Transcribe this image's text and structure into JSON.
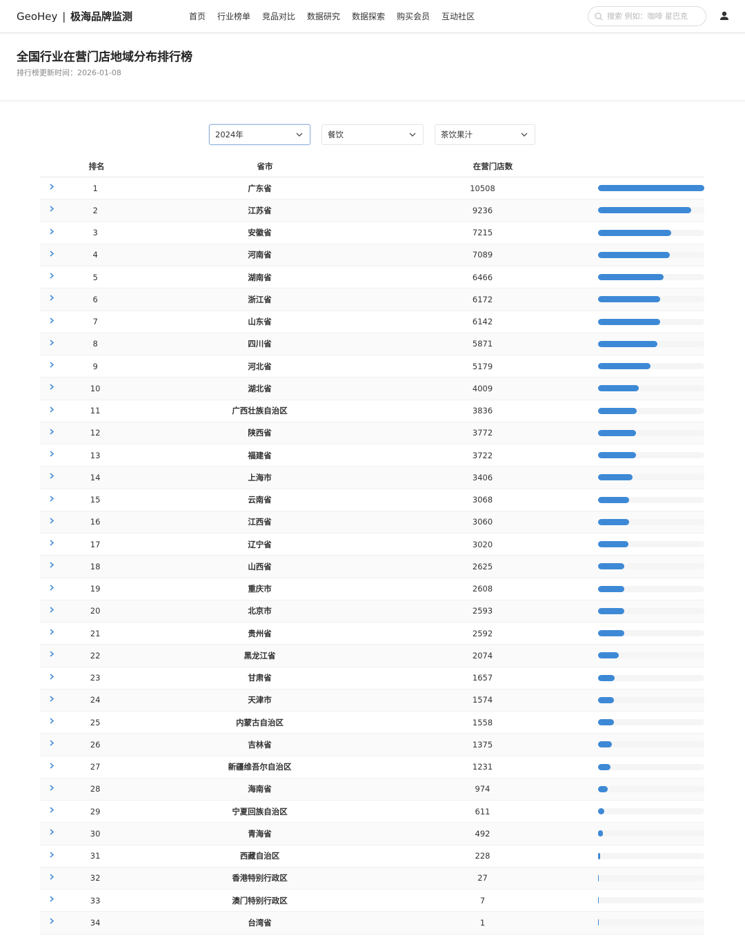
{
  "brand": {
    "en": "GeoHey",
    "sep": "|",
    "cn": "极海品牌监测"
  },
  "nav": [
    "首页",
    "行业榜单",
    "竞品对比",
    "数据研究",
    "数据探索",
    "购买会员",
    "互动社区"
  ],
  "search": {
    "placeholder": "搜索 例如：咖啡 星巴克"
  },
  "page": {
    "title": "全国行业在营门店地域分布排行榜",
    "update_time": "排行榜更新时间：2026-01-08"
  },
  "filters": {
    "year": "2024年",
    "industry": "餐饮",
    "category": "茶饮果汁"
  },
  "table": {
    "headers": {
      "rank": "排名",
      "province": "省市",
      "count": "在营门店数"
    },
    "max_value": 10508,
    "rows": [
      {
        "rank": "1",
        "province": "广东省",
        "count": "10508",
        "value": 10508
      },
      {
        "rank": "2",
        "province": "江苏省",
        "count": "9236",
        "value": 9236
      },
      {
        "rank": "3",
        "province": "安徽省",
        "count": "7215",
        "value": 7215
      },
      {
        "rank": "4",
        "province": "河南省",
        "count": "7089",
        "value": 7089
      },
      {
        "rank": "5",
        "province": "湖南省",
        "count": "6466",
        "value": 6466
      },
      {
        "rank": "6",
        "province": "浙江省",
        "count": "6172",
        "value": 6172
      },
      {
        "rank": "7",
        "province": "山东省",
        "count": "6142",
        "value": 6142
      },
      {
        "rank": "8",
        "province": "四川省",
        "count": "5871",
        "value": 5871
      },
      {
        "rank": "9",
        "province": "河北省",
        "count": "5179",
        "value": 5179
      },
      {
        "rank": "10",
        "province": "湖北省",
        "count": "4009",
        "value": 4009
      },
      {
        "rank": "11",
        "province": "广西壮族自治区",
        "count": "3836",
        "value": 3836
      },
      {
        "rank": "12",
        "province": "陕西省",
        "count": "3772",
        "value": 3772
      },
      {
        "rank": "13",
        "province": "福建省",
        "count": "3722",
        "value": 3722
      },
      {
        "rank": "14",
        "province": "上海市",
        "count": "3406",
        "value": 3406
      },
      {
        "rank": "15",
        "province": "云南省",
        "count": "3068",
        "value": 3068
      },
      {
        "rank": "16",
        "province": "江西省",
        "count": "3060",
        "value": 3060
      },
      {
        "rank": "17",
        "province": "辽宁省",
        "count": "3020",
        "value": 3020
      },
      {
        "rank": "18",
        "province": "山西省",
        "count": "2625",
        "value": 2625
      },
      {
        "rank": "19",
        "province": "重庆市",
        "count": "2608",
        "value": 2608
      },
      {
        "rank": "20",
        "province": "北京市",
        "count": "2593",
        "value": 2593
      },
      {
        "rank": "21",
        "province": "贵州省",
        "count": "2592",
        "value": 2592
      },
      {
        "rank": "22",
        "province": "黑龙江省",
        "count": "2074",
        "value": 2074
      },
      {
        "rank": "23",
        "province": "甘肃省",
        "count": "1657",
        "value": 1657
      },
      {
        "rank": "24",
        "province": "天津市",
        "count": "1574",
        "value": 1574
      },
      {
        "rank": "25",
        "province": "内蒙古自治区",
        "count": "1558",
        "value": 1558
      },
      {
        "rank": "26",
        "province": "吉林省",
        "count": "1375",
        "value": 1375
      },
      {
        "rank": "27",
        "province": "新疆维吾尔自治区",
        "count": "1231",
        "value": 1231
      },
      {
        "rank": "28",
        "province": "海南省",
        "count": "974",
        "value": 974
      },
      {
        "rank": "29",
        "province": "宁夏回族自治区",
        "count": "611",
        "value": 611
      },
      {
        "rank": "30",
        "province": "青海省",
        "count": "492",
        "value": 492
      },
      {
        "rank": "31",
        "province": "西藏自治区",
        "count": "228",
        "value": 228
      },
      {
        "rank": "32",
        "province": "香港特别行政区",
        "count": "27",
        "value": 27
      },
      {
        "rank": "33",
        "province": "澳门特别行政区",
        "count": "7",
        "value": 7
      },
      {
        "rank": "34",
        "province": "台湾省",
        "count": "1",
        "value": 1
      }
    ]
  },
  "colors": {
    "bar": "#3d89d6",
    "bar_track": "#f5f5f5",
    "chevron": "#3d89d6"
  }
}
